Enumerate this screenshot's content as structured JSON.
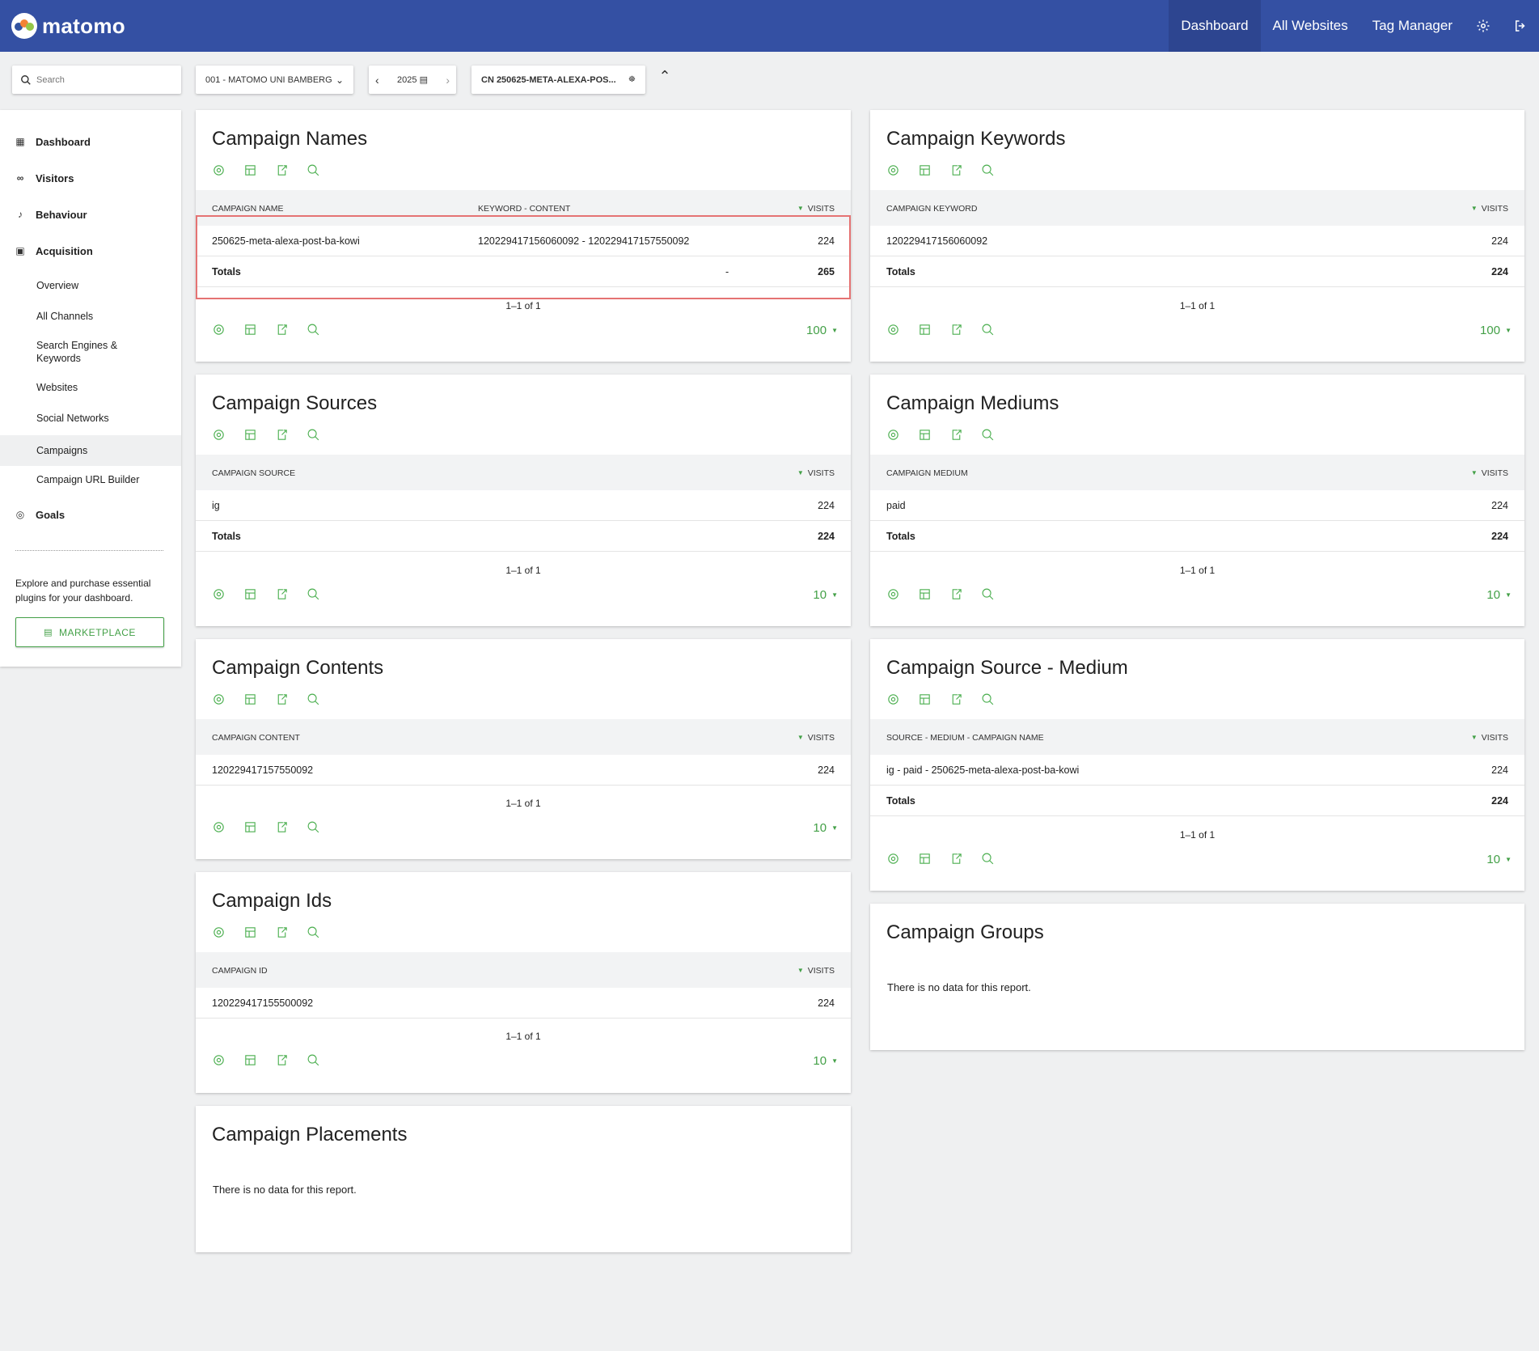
{
  "app": {
    "logo_text": "matomo",
    "logo_icon": "matomo-logo-icon"
  },
  "topnav": {
    "items": [
      {
        "label": "Dashboard",
        "active": true
      },
      {
        "label": "All Websites"
      },
      {
        "label": "Tag Manager"
      }
    ],
    "icons": [
      "gear-icon",
      "logout-icon"
    ]
  },
  "controls": {
    "search_placeholder": "Search",
    "site_selector": "001 - MATOMO UNI BAMBERG",
    "period": "2025",
    "segment": "CN 250625-META-ALEXA-POS..."
  },
  "sidebar": {
    "categories": [
      {
        "label": "Dashboard",
        "icon": "dashboard-grid-icon"
      },
      {
        "label": "Visitors",
        "icon": "visitors-glasses-icon"
      },
      {
        "label": "Behaviour",
        "icon": "bell-icon"
      },
      {
        "label": "Acquisition",
        "icon": "acquisition-window-icon"
      },
      {
        "label": "Goals",
        "icon": "target-icon"
      }
    ],
    "acquisition_items": [
      "Overview",
      "All Channels",
      "Search Engines & Keywords",
      "Websites",
      "Social Networks",
      "Campaigns",
      "Campaign URL Builder"
    ],
    "active_item": "Campaigns",
    "promo_text": "Explore and purchase essential plugins for your dashboard.",
    "marketplace_label": "MARKETPLACE"
  },
  "widgets": {
    "campaign_names": {
      "title": "Campaign Names",
      "col1": "CAMPAIGN NAME",
      "col2": "KEYWORD - CONTENT",
      "col3": "VISITS",
      "row": {
        "name": "250625-meta-alexa-post-ba-kowi",
        "keyword": "120229417156060092 - 120229417157550092",
        "visits": "224"
      },
      "totals": {
        "label": "Totals",
        "keyword": "-",
        "visits": "265"
      },
      "pager": "1–1 of 1",
      "limit": "100"
    },
    "campaign_keywords": {
      "title": "Campaign Keywords",
      "col1": "CAMPAIGN KEYWORD",
      "col3": "VISITS",
      "row": {
        "name": "120229417156060092",
        "visits": "224"
      },
      "totals": {
        "label": "Totals",
        "visits": "224"
      },
      "pager": "1–1 of 1",
      "limit": "100"
    },
    "campaign_sources": {
      "title": "Campaign Sources",
      "col1": "CAMPAIGN SOURCE",
      "col3": "VISITS",
      "row": {
        "name": "ig",
        "visits": "224"
      },
      "totals": {
        "label": "Totals",
        "visits": "224"
      },
      "pager": "1–1 of 1",
      "limit": "10"
    },
    "campaign_mediums": {
      "title": "Campaign Mediums",
      "col1": "CAMPAIGN MEDIUM",
      "col3": "VISITS",
      "row": {
        "name": "paid",
        "visits": "224"
      },
      "totals": {
        "label": "Totals",
        "visits": "224"
      },
      "pager": "1–1 of 1",
      "limit": "10"
    },
    "campaign_contents": {
      "title": "Campaign Contents",
      "col1": "CAMPAIGN CONTENT",
      "col3": "VISITS",
      "row": {
        "name": "120229417157550092",
        "visits": "224"
      },
      "pager": "1–1 of 1",
      "limit": "10"
    },
    "campaign_source_medium": {
      "title": "Campaign Source - Medium",
      "col1": "SOURCE - MEDIUM - CAMPAIGN NAME",
      "col3": "VISITS",
      "row": {
        "name": "ig - paid - 250625-meta-alexa-post-ba-kowi",
        "visits": "224"
      },
      "totals": {
        "label": "Totals",
        "visits": "224"
      },
      "pager": "1–1 of 1",
      "limit": "10"
    },
    "campaign_ids": {
      "title": "Campaign Ids",
      "col1": "CAMPAIGN ID",
      "col3": "VISITS",
      "row": {
        "name": "120229417155500092",
        "visits": "224"
      },
      "pager": "1–1 of 1",
      "limit": "10"
    },
    "campaign_groups": {
      "title": "Campaign Groups",
      "nodata": "There is no data for this report."
    },
    "campaign_placements": {
      "title": "Campaign Placements",
      "nodata": "There is no data for this report."
    }
  }
}
